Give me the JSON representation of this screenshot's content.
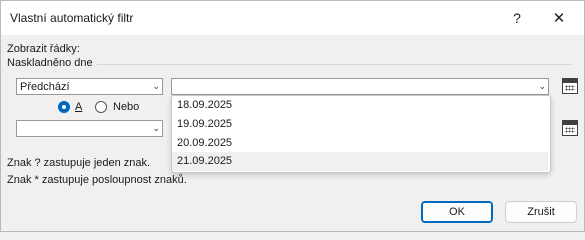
{
  "window": {
    "title": "Vlastní automatický filtr",
    "help_glyph": "?",
    "close_glyph": "✕"
  },
  "labels": {
    "show_rows": "Zobrazit řádky:",
    "field_name": "Naskladněno dne"
  },
  "criteria1": {
    "operator": "Předchází",
    "value": ""
  },
  "logic": {
    "and_label": "A",
    "or_label": "Nebo",
    "selected": "A"
  },
  "criteria2": {
    "operator": "",
    "value": ""
  },
  "dropdown": {
    "items": [
      "18.09.2025",
      "19.09.2025",
      "20.09.2025",
      "21.09.2025"
    ],
    "highlighted": "21.09.2025"
  },
  "hints": {
    "single_char": "Znak ? zastupuje jeden znak.",
    "multi_char": "Znak * zastupuje posloupnost znaků."
  },
  "buttons": {
    "ok": "OK",
    "cancel": "Zrušit"
  },
  "colors": {
    "accent": "#0067c0",
    "dialog_bg": "#f0f0f0",
    "titlebar_bg": "#ffffff"
  },
  "icons": {
    "calendar": "calendar-icon",
    "dropdown_arrow": "chevron-down-icon"
  }
}
